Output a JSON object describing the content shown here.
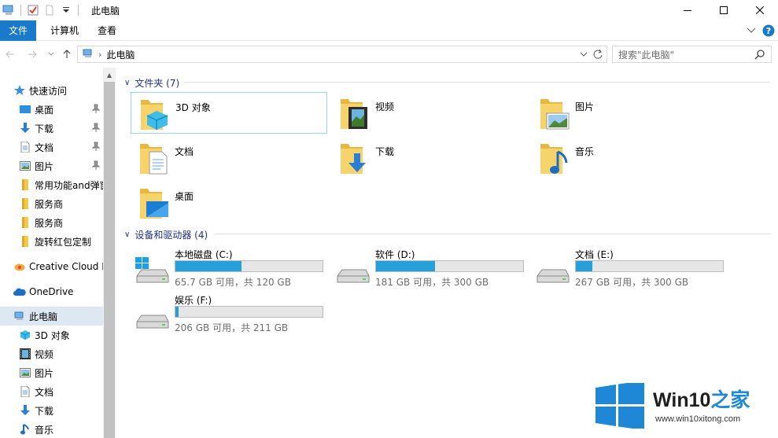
{
  "window": {
    "title": "此电脑",
    "controls": {
      "minimize": "minimize-icon",
      "maximize": "maximize-icon",
      "close": "close-icon"
    }
  },
  "ribbon": {
    "tabs": [
      {
        "label": "文件",
        "active": true
      },
      {
        "label": "计算机"
      },
      {
        "label": "查看"
      }
    ],
    "accent": "#1979ca"
  },
  "address": {
    "path": "此电脑",
    "search_placeholder": "搜索\"此电脑\""
  },
  "sidebar": {
    "items": [
      {
        "label": "快速访问",
        "icon": "star-icon"
      },
      {
        "label": "桌面",
        "icon": "desktop-icon",
        "pinned": true
      },
      {
        "label": "下载",
        "icon": "download-icon",
        "pinned": true
      },
      {
        "label": "文档",
        "icon": "document-icon",
        "pinned": true
      },
      {
        "label": "图片",
        "icon": "picture-icon",
        "pinned": true
      },
      {
        "label": "常用功能and弹窗",
        "icon": "folder-icon"
      },
      {
        "label": "服务商",
        "icon": "folder-icon"
      },
      {
        "label": "服务商",
        "icon": "folder-icon"
      },
      {
        "label": "旋转红包定制",
        "icon": "folder-icon"
      },
      {
        "label": "Creative Cloud F",
        "icon": "creative-cloud-icon"
      },
      {
        "label": "OneDrive",
        "icon": "cloud-icon"
      },
      {
        "label": "此电脑",
        "icon": "computer-icon",
        "selected": true
      },
      {
        "label": "3D 对象",
        "icon": "cube-icon"
      },
      {
        "label": "视频",
        "icon": "video-icon"
      },
      {
        "label": "图片",
        "icon": "picture-icon"
      },
      {
        "label": "文档",
        "icon": "document-icon"
      },
      {
        "label": "下载",
        "icon": "download-icon"
      },
      {
        "label": "音乐",
        "icon": "music-icon"
      }
    ]
  },
  "folders_group": {
    "header": "文件夹 (7)",
    "items": [
      {
        "label": "3D 对象",
        "icon": "cube-folder-icon",
        "selected": true
      },
      {
        "label": "视频",
        "icon": "video-folder-icon"
      },
      {
        "label": "图片",
        "icon": "picture-folder-icon"
      },
      {
        "label": "文档",
        "icon": "document-folder-icon"
      },
      {
        "label": "下载",
        "icon": "download-folder-icon"
      },
      {
        "label": "音乐",
        "icon": "music-folder-icon"
      },
      {
        "label": "桌面",
        "icon": "desktop-folder-icon"
      }
    ]
  },
  "drives_group": {
    "header": "设备和驱动器 (4)",
    "items": [
      {
        "label": "本地磁盘 (C:)",
        "free_text": "65.7 GB 可用，共 120 GB",
        "used_fraction": 0.45,
        "icon": "windows-drive-icon"
      },
      {
        "label": "软件 (D:)",
        "free_text": "181 GB 可用，共 300 GB",
        "used_fraction": 0.4,
        "icon": "hard-drive-icon"
      },
      {
        "label": "文档 (E:)",
        "free_text": "267 GB 可用，共 300 GB",
        "used_fraction": 0.11,
        "icon": "hard-drive-icon"
      },
      {
        "label": "娱乐 (F:)",
        "free_text": "206 GB 可用，共 211 GB",
        "used_fraction": 0.02,
        "icon": "hard-drive-icon"
      }
    ],
    "bar_color": "#26a0da"
  },
  "watermark": {
    "brand_prefix": "Win10",
    "brand_suffix": "之家",
    "url": "www.win10xitong.com"
  }
}
